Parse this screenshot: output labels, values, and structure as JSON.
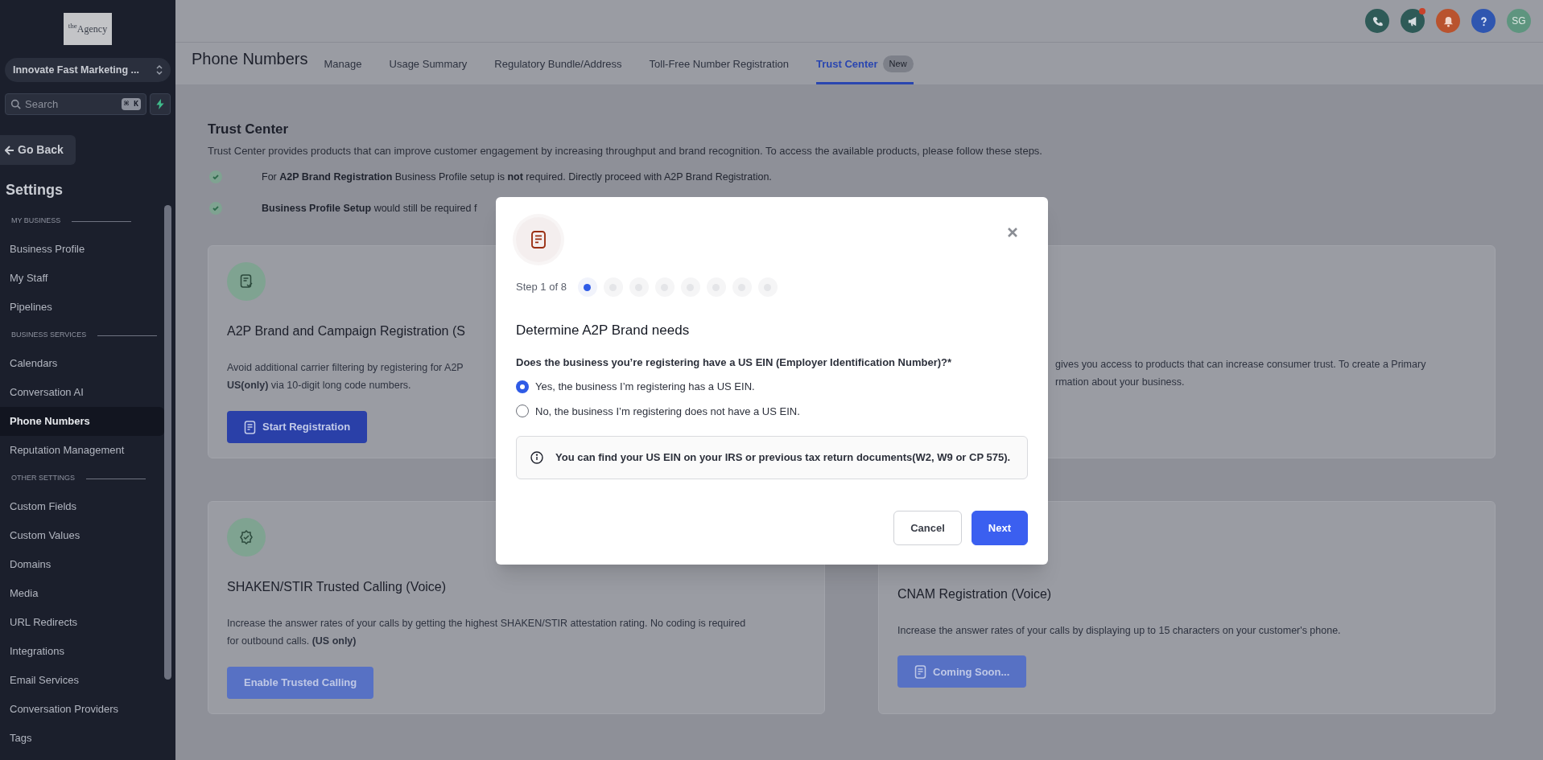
{
  "sidebar": {
    "logo": "$^{the}$Agency",
    "account": "Innovate Fast Marketing ...",
    "search": {
      "placeholder": "Search",
      "shortcut": "⌘ K"
    },
    "back_button": "Go Back",
    "title": "Settings",
    "sections": [
      {
        "heading": "MY BUSINESS",
        "items": [
          {
            "label": "Business Profile",
            "selected": false
          },
          {
            "label": "My Staff",
            "selected": false
          },
          {
            "label": "Pipelines",
            "selected": false
          }
        ]
      },
      {
        "heading": "BUSINESS SERVICES",
        "items": [
          {
            "label": "Calendars",
            "selected": false
          },
          {
            "label": "Conversation AI",
            "selected": false
          },
          {
            "label": "Phone Numbers",
            "selected": true
          },
          {
            "label": "Reputation Management",
            "selected": false
          }
        ]
      },
      {
        "heading": "OTHER SETTINGS",
        "items": [
          {
            "label": "Custom Fields",
            "selected": false
          },
          {
            "label": "Custom Values",
            "selected": false
          },
          {
            "label": "Domains",
            "selected": false
          },
          {
            "label": "Media",
            "selected": false
          },
          {
            "label": "URL Redirects",
            "selected": false
          },
          {
            "label": "Integrations",
            "selected": false
          },
          {
            "label": "Email Services",
            "selected": false
          },
          {
            "label": "Conversation Providers",
            "selected": false
          },
          {
            "label": "Tags",
            "selected": false
          }
        ]
      }
    ]
  },
  "top_bar": {
    "buttons": [
      {
        "kind": "phone",
        "color": "#2e5a57",
        "badge": false
      },
      {
        "kind": "megaphone",
        "color": "#2e5a57",
        "badge": true
      },
      {
        "kind": "bell",
        "color": "#b9532e",
        "badge": false
      },
      {
        "kind": "help",
        "color": "#2f56b0",
        "badge": false
      },
      {
        "kind": "avatar",
        "color": "#5e957f",
        "badge": false,
        "label": "SG"
      }
    ]
  },
  "header": {
    "title": "Phone Numbers",
    "tabs": [
      {
        "label": "Manage",
        "selected": false
      },
      {
        "label": "Usage Summary",
        "selected": false
      },
      {
        "label": "Regulatory Bundle/Address",
        "selected": false
      },
      {
        "label": "Toll-Free Number Registration",
        "selected": false
      },
      {
        "label": "Trust Center",
        "selected": true,
        "badge": "New"
      }
    ]
  },
  "trust_center": {
    "title": "Trust Center",
    "description": "Trust Center provides products that can improve customer engagement by increasing throughput and brand recognition. To access the available products, please follow these steps.",
    "steps": [
      {
        "text": "For **A2P Brand Registration** Business Profile setup is **not** required. Directly proceed with A2P Brand Registration."
      },
      {
        "text": "**Business Profile Setup** would still be required f"
      }
    ]
  },
  "cards": [
    {
      "kind": "with_icon",
      "title": "A2P Brand and Campaign Registration (S",
      "description": [
        "Avoid additional carrier filtering by registering for A2P",
        "**US(only)** via 10-digit long code numbers."
      ],
      "button": {
        "label": "Start Registration",
        "has_icon": true,
        "disabled": false
      }
    },
    {
      "kind": "text_only",
      "description": [
        "gives you access to products that can increase consumer trust. To create a Primary",
        "rmation about your business."
      ]
    },
    {
      "kind": "with_icon",
      "title": "SHAKEN/STIR Trusted Calling (Voice)",
      "description": [
        "Increase the answer rates of your calls by getting the highest SHAKEN/STIR attestation rating. No coding is required",
        "for outbound calls. **(US only)**"
      ],
      "button": {
        "label": "Enable Trusted Calling",
        "has_icon": false,
        "disabled": true
      }
    },
    {
      "kind": "no_icon",
      "title": "CNAM Registration (Voice)",
      "description": [
        "Increase the answer rates of your calls by displaying up to 15 characters on your customer's phone."
      ],
      "button": {
        "label": "Coming Soon...",
        "has_icon": true,
        "disabled": true
      }
    }
  ],
  "modal": {
    "step_label": "Step 1 of 8",
    "steps": [
      {
        "current": true
      },
      {
        "current": false
      },
      {
        "current": false
      },
      {
        "current": false
      },
      {
        "current": false
      },
      {
        "current": false
      },
      {
        "current": false
      },
      {
        "current": false
      }
    ],
    "title": "Determine A2P Brand needs",
    "question": "Does the business you’re registering have a US EIN (Employer Identification Number)?*",
    "options": [
      {
        "label": "Yes, the business I’m registering has a US EIN.",
        "selected": true
      },
      {
        "label": "No, the business I’m registering does not have a US EIN.",
        "selected": false
      }
    ],
    "info": "You can find your US EIN on your IRS or previous tax return documents(W2, W9 or CP 575).",
    "buttons": [
      {
        "label": "Cancel",
        "kind": "secondary"
      },
      {
        "label": "Next",
        "kind": "primary"
      }
    ]
  }
}
